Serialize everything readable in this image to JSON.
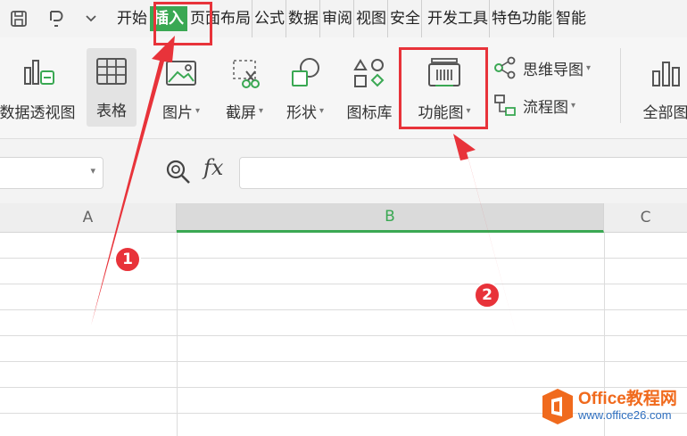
{
  "menubar": {
    "tabs": [
      {
        "label": "开始"
      },
      {
        "label": "插入"
      },
      {
        "label": "页面布局"
      },
      {
        "label": "公式"
      },
      {
        "label": "数据"
      },
      {
        "label": "审阅"
      },
      {
        "label": "视图"
      },
      {
        "label": "安全"
      },
      {
        "label": "开发工具"
      },
      {
        "label": "特色功能"
      },
      {
        "label": "智能"
      }
    ],
    "active_tab": "插入"
  },
  "ribbon": {
    "pivot": "数据透视图",
    "table": "表格",
    "picture": "图片",
    "screenshot": "截屏",
    "shapes": "形状",
    "icon_library": "图标库",
    "function_chart": "功能图",
    "mindmap": "思维导图",
    "flowchart": "流程图",
    "all_charts": "全部图"
  },
  "formula_bar": {
    "fx": "fx"
  },
  "sheet": {
    "columns": [
      "A",
      "B",
      "C"
    ],
    "selected_column": "B"
  },
  "annotations": {
    "badge1": "1",
    "badge2": "2"
  },
  "watermark": {
    "title": "Office教程网",
    "url": "www.office26.com"
  },
  "colors": {
    "accent_green": "#3aa853",
    "annotation_red": "#e8333a",
    "watermark_orange": "#f06a1d",
    "watermark_blue": "#2f6fbf"
  }
}
